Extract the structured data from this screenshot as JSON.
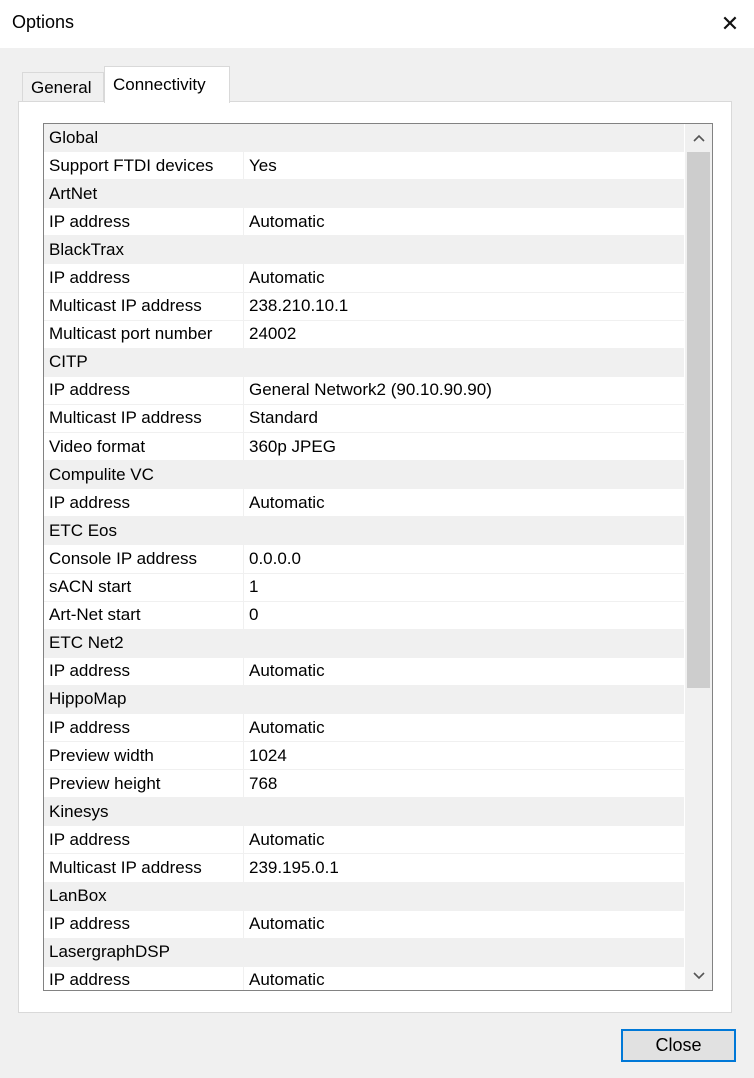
{
  "window": {
    "title": "Options",
    "close_glyph": "✕"
  },
  "tabs": [
    {
      "label": "General",
      "active": false
    },
    {
      "label": "Connectivity",
      "active": true
    }
  ],
  "properties": [
    {
      "type": "category",
      "name": "Global"
    },
    {
      "type": "item",
      "name": "Support FTDI devices",
      "value": "Yes"
    },
    {
      "type": "category",
      "name": "ArtNet"
    },
    {
      "type": "item",
      "name": "IP address",
      "value": "Automatic"
    },
    {
      "type": "category",
      "name": "BlackTrax"
    },
    {
      "type": "item",
      "name": "IP address",
      "value": "Automatic"
    },
    {
      "type": "item",
      "name": "Multicast IP address",
      "value": "238.210.10.1"
    },
    {
      "type": "item",
      "name": "Multicast port number",
      "value": "24002"
    },
    {
      "type": "category",
      "name": "CITP"
    },
    {
      "type": "item",
      "name": "IP address",
      "value": "General Network2 (90.10.90.90)"
    },
    {
      "type": "item",
      "name": "Multicast IP address",
      "value": "Standard"
    },
    {
      "type": "item",
      "name": "Video format",
      "value": "360p JPEG"
    },
    {
      "type": "category",
      "name": "Compulite VC"
    },
    {
      "type": "item",
      "name": "IP address",
      "value": "Automatic"
    },
    {
      "type": "category",
      "name": "ETC Eos"
    },
    {
      "type": "item",
      "name": "Console IP address",
      "value": "0.0.0.0"
    },
    {
      "type": "item",
      "name": "sACN start",
      "value": "1"
    },
    {
      "type": "item",
      "name": "Art-Net start",
      "value": "0"
    },
    {
      "type": "category",
      "name": "ETC Net2"
    },
    {
      "type": "item",
      "name": "IP address",
      "value": "Automatic"
    },
    {
      "type": "category",
      "name": "HippoMap"
    },
    {
      "type": "item",
      "name": "IP address",
      "value": "Automatic"
    },
    {
      "type": "item",
      "name": "Preview width",
      "value": "1024"
    },
    {
      "type": "item",
      "name": "Preview height",
      "value": "768"
    },
    {
      "type": "category",
      "name": "Kinesys"
    },
    {
      "type": "item",
      "name": "IP address",
      "value": "Automatic"
    },
    {
      "type": "item",
      "name": "Multicast IP address",
      "value": "239.195.0.1"
    },
    {
      "type": "category",
      "name": "LanBox"
    },
    {
      "type": "item",
      "name": "IP address",
      "value": "Automatic"
    },
    {
      "type": "category",
      "name": "LasergraphDSP"
    },
    {
      "type": "item",
      "name": "IP address",
      "value": "Automatic"
    }
  ],
  "scrollbar": {
    "up_icon": "chevron-up-icon",
    "down_icon": "chevron-down-icon"
  },
  "footer": {
    "close_label": "Close"
  },
  "colors": {
    "accent": "#0078d7",
    "category_bg": "#f0f0f0",
    "thumb": "#cdcdcd"
  }
}
